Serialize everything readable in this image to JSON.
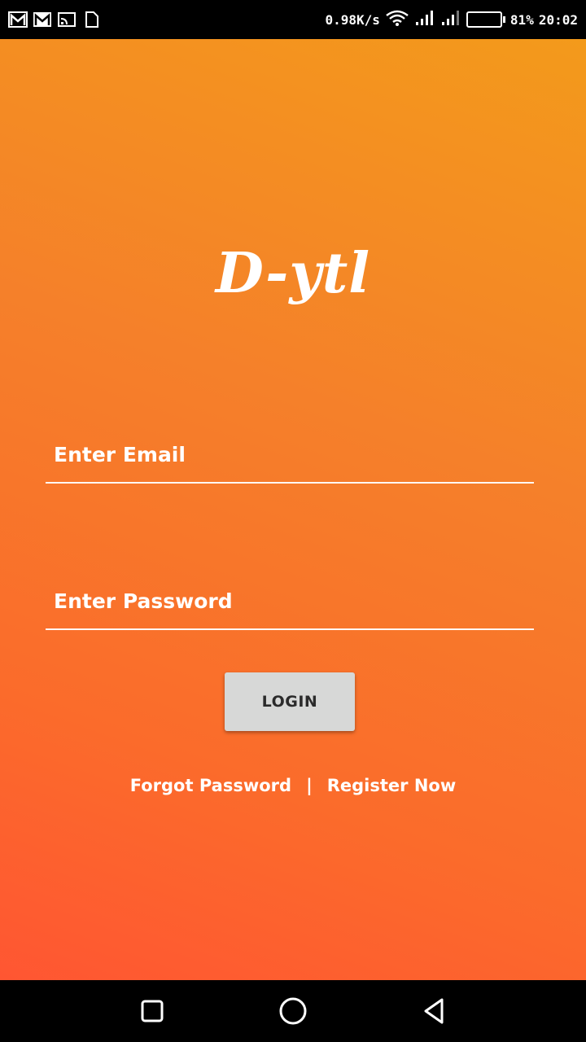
{
  "status_bar": {
    "left_icons": [
      "gmail-icon",
      "gmail-icon",
      "cast-icon",
      "sd-card-icon"
    ],
    "network_speed": "0.98K/s",
    "battery_percent_text": "81%",
    "battery_level": 0.81,
    "time": "20:02"
  },
  "app": {
    "logo_text": "D-ytl",
    "email_placeholder": "Enter Email",
    "password_placeholder": "Enter Password",
    "login_label": "LOGIN",
    "forgot_label": "Forgot Password",
    "separator": "|",
    "register_label": "Register Now",
    "gradient_colors": [
      "#f39a1b",
      "#ff5632"
    ]
  },
  "nav_bar": {
    "icons": [
      "recents-square-icon",
      "home-circle-icon",
      "back-triangle-icon"
    ]
  }
}
